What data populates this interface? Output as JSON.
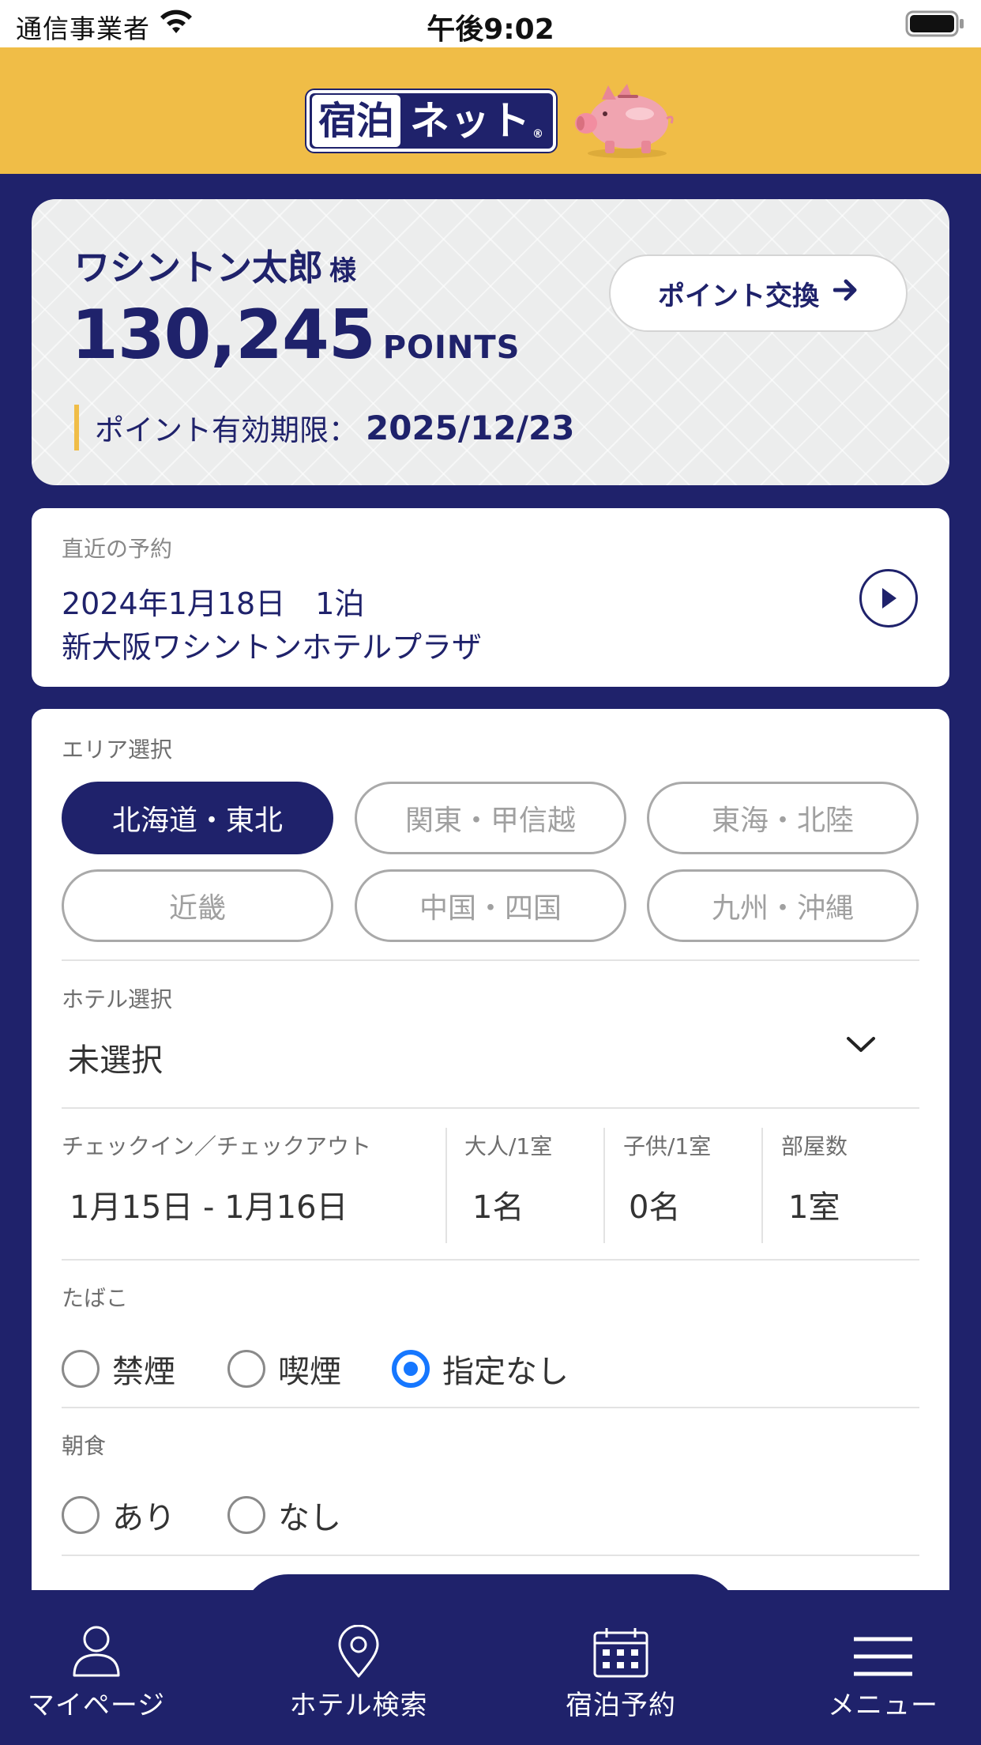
{
  "status_bar": {
    "carrier": "通信事業者",
    "time": "午後9:02"
  },
  "header": {
    "logo_text_a": "宿泊",
    "logo_text_b": "ネット",
    "logo_mark": "®"
  },
  "points": {
    "name": "ワシントン太郎",
    "honorific": "様",
    "value": "130,245",
    "unit": "POINTS",
    "exchange_label": "ポイント交換",
    "expiry_label": "ポイント有効期限：",
    "expiry_date": "2025/12/23"
  },
  "recent": {
    "label": "直近の予約",
    "date": "2024年1月18日　1泊",
    "hotel": "新大阪ワシントンホテルプラザ"
  },
  "search": {
    "area_label": "エリア選択",
    "areas": [
      {
        "label": "北海道・東北",
        "active": true
      },
      {
        "label": "関東・甲信越",
        "active": false
      },
      {
        "label": "東海・北陸",
        "active": false
      },
      {
        "label": "近畿",
        "active": false
      },
      {
        "label": "中国・四国",
        "active": false
      },
      {
        "label": "九州・沖縄",
        "active": false
      }
    ],
    "hotel_label": "ホテル選択",
    "hotel_value": "未選択",
    "checkin_label": "チェックイン／チェックアウト",
    "checkin_value": "1月15日 - 1月16日",
    "adults_label": "大人/1室",
    "adults_value": "1名",
    "children_label": "子供/1室",
    "children_value": "0名",
    "rooms_label": "部屋数",
    "rooms_value": "1室",
    "smoking_label": "たばこ",
    "smoking_options": [
      "禁煙",
      "喫煙",
      "指定なし"
    ],
    "smoking_selected": "指定なし",
    "breakfast_label": "朝食",
    "breakfast_options": [
      "あり",
      "なし"
    ],
    "breakfast_selected": null
  },
  "tabbar": {
    "items": [
      {
        "label": "マイページ",
        "icon": "person-icon"
      },
      {
        "label": "ホテル検索",
        "icon": "map-pin-icon"
      },
      {
        "label": "宿泊予約",
        "icon": "calendar-icon"
      },
      {
        "label": "メニュー",
        "icon": "hamburger-menu-icon"
      }
    ]
  },
  "colors": {
    "navy": "#1f226b",
    "gold": "#f0bd47",
    "radio_blue": "#1677ff"
  }
}
